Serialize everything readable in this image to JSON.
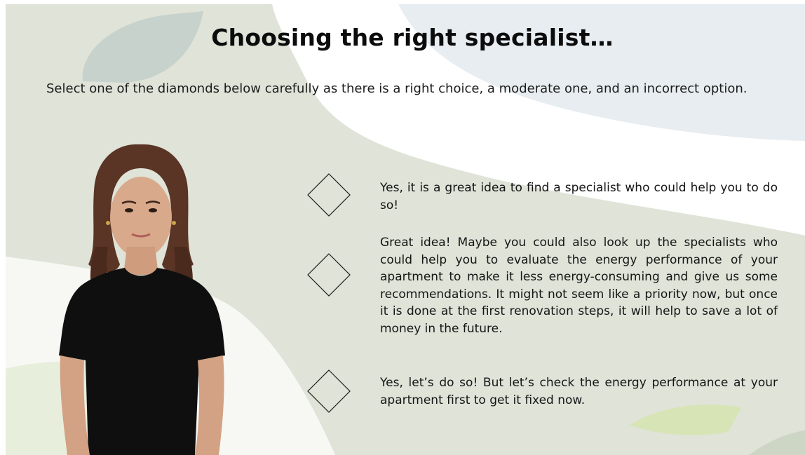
{
  "slide": {
    "title": "Choosing the right specialist…",
    "instruction": "Select one of the diamonds below carefully as there is a right choice, a moderate one, and an incorrect option."
  },
  "presenter": {
    "description": "presenter-avatar"
  },
  "choices": [
    {
      "icon": "diamond-icon",
      "text": "Yes, it is a great idea to find a specialist who could help you to do so!"
    },
    {
      "icon": "diamond-icon",
      "text": "Great idea! Maybe you could also look up the specialists who could help you to evaluate the energy performance of your apartment to make it less energy-consuming and give us some recommendations. It might not seem like a priority now, but once it is done at the first renovation steps, it will help to save a lot of money in the future."
    },
    {
      "icon": "diamond-icon",
      "text": "Yes, let’s do so! But let’s check the energy performance at your apartment first to get it fixed now."
    }
  ],
  "colors": {
    "background": "#dfe3d8",
    "blob_white": "#ffffff",
    "blob_blue": "#e6edf0",
    "blob_leaf": "#c6d2cc",
    "blob_green": "#dbe6c8",
    "text": "#151515"
  }
}
